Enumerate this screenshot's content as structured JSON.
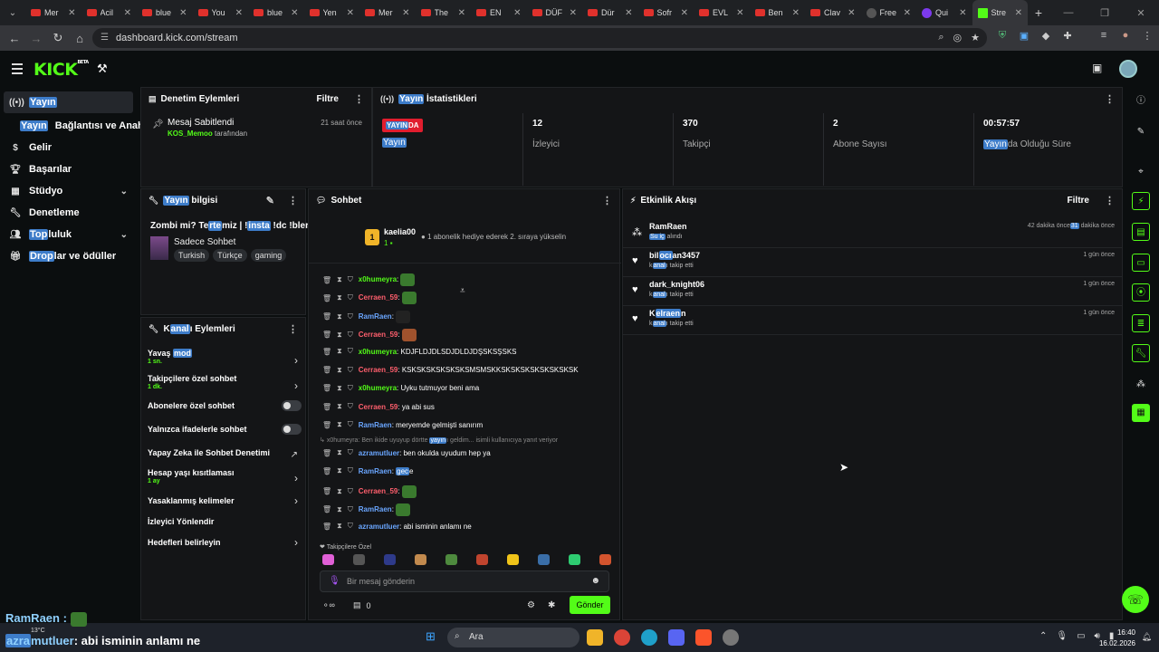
{
  "browser": {
    "tabs": [
      {
        "title": "Mer",
        "icon": "youtube-icon"
      },
      {
        "title": "Acil",
        "icon": "youtube-icon"
      },
      {
        "title": "blue",
        "icon": "youtube-icon"
      },
      {
        "title": "You",
        "icon": "youtube-icon"
      },
      {
        "title": "blue",
        "icon": "youtube-icon"
      },
      {
        "title": "Yen",
        "icon": "youtube-icon"
      },
      {
        "title": "Mer",
        "icon": "youtube-icon"
      },
      {
        "title": "The",
        "icon": "youtube-icon"
      },
      {
        "title": "EN",
        "icon": "youtube-icon"
      },
      {
        "title": "DÜF",
        "icon": "youtube-icon"
      },
      {
        "title": "Dür",
        "icon": "youtube-icon"
      },
      {
        "title": "Sofr",
        "icon": "youtube-icon"
      },
      {
        "title": "EVL",
        "icon": "youtube-icon"
      },
      {
        "title": "Ben",
        "icon": "youtube-icon"
      },
      {
        "title": "Clav",
        "icon": "youtube-icon"
      },
      {
        "title": "Free",
        "icon": "globe-icon"
      },
      {
        "title": "Qui",
        "icon": "quiz-icon"
      },
      {
        "title": "Stre",
        "icon": "kick-icon"
      }
    ],
    "url": "dashboard.kick.com/stream"
  },
  "sidebar": {
    "items": [
      {
        "label": "Yayın",
        "icon": "broadcast-icon"
      },
      {
        "label": "Bağlantısı ve Anahtar",
        "highlight": "Yayın"
      },
      {
        "label": "Gelir",
        "icon": "dollar-icon"
      },
      {
        "label": "Başarılar",
        "icon": "trophy-icon"
      },
      {
        "label": "Stüdyo",
        "icon": "grid-icon"
      },
      {
        "label": "Denetleme",
        "icon": "wrench-icon"
      },
      {
        "label": "luluk",
        "highlight": "Top",
        "icon": "community-icon"
      },
      {
        "label": "lar ve ödüller",
        "highlight": "Drop",
        "icon": "gift-icon"
      }
    ]
  },
  "moderation": {
    "title": "Denetim Eylemleri",
    "filter": "Filtre",
    "entry_title": "Mesaj Sabitlendi",
    "entry_user": "KOS_Memoo",
    "entry_suffix": "tarafından",
    "entry_time": "21 saat önce"
  },
  "stats": {
    "title_hl": "Yayın",
    "title_rest": " İstatistikleri",
    "live_badge_hl": "YAYIN",
    "live_badge_rest": "DA",
    "live_label": "Yayın",
    "viewers": "12",
    "viewers_label": "İzleyici",
    "followers": "370",
    "followers_label": "Takipçi",
    "subs": "2",
    "subs_label": "Abone Sayısı",
    "uptime": "00:57:57",
    "uptime_label_hl": "Yayın",
    "uptime_label_rest": "da Olduğu Süre"
  },
  "stream_info": {
    "title_hl": "Yayın",
    "title_rest": " bilgisi",
    "stream_title_a": "Zombi mi? Te",
    "stream_title_hl1": "rte",
    "stream_title_b": "miz | !",
    "stream_title_hl2": "insta",
    "stream_title_c": " !dc !blerp",
    "category": "Sadece Sohbet",
    "tags": [
      "Turkish",
      "Türkçe",
      "gaming"
    ]
  },
  "channel_actions": {
    "title_a": "K",
    "title_hl": "anal",
    "title_b": "ı Eylemleri",
    "slow_a": "Yavaş ",
    "slow_hl": "mod",
    "slow_sub": "1 sn.",
    "followers_only": "Takipçilere özel sohbet",
    "followers_only_sub": "1 dk.",
    "subs_only": "Abonelere özel sohbet",
    "emote_only": "Yalnızca ifadelerle sohbet",
    "ai_mod": "Yapay Zeka ile Sohbet Denetimi",
    "account_age": "Hesap yaşı kısıtlaması",
    "account_age_sub": "1 ay",
    "banned_words": "Yasaklanmış kelimeler",
    "viewer_redirect": "İzleyici Yönlendir",
    "goals": "Hedefleri belirleyin"
  },
  "chat": {
    "title": "Sohbet",
    "gift_badge": "1",
    "gift_user": "kaelia00",
    "gift_count": "1",
    "gift_msg": "1 abonelik hediye ederek 2. sıraya yükselin",
    "messages": [
      {
        "user": "x0humeyra",
        "text": "",
        "color": "#53fc18",
        "emote": "green"
      },
      {
        "user": "Cerraen_59",
        "text": "",
        "color": "#ff5f6d",
        "emote": "green"
      },
      {
        "user": "RamRaen",
        "text": "",
        "color": "#6aa6ff",
        "emote": "dark"
      },
      {
        "user": "Cerraen_59",
        "text": "",
        "color": "#ff5f6d",
        "emote": "brown"
      },
      {
        "user": "x0humeyra",
        "text": "KDJFLDJDLSDJDLDJDŞSKSŞSKS",
        "color": "#53fc18"
      },
      {
        "user": "Cerraen_59",
        "text": "KSKSKSKSKSKSKSMSMSKKSKSKSKSKSKSKSKSK",
        "color": "#ff5f6d"
      },
      {
        "user": "x0humeyra",
        "text": "Uyku tutmuyor beni ama",
        "color": "#53fc18"
      },
      {
        "user": "Cerraen_59",
        "text": "ya abi sus",
        "color": "#ff5f6d"
      },
      {
        "user": "RamRaen",
        "text": "meryemde gelmişti sanırım",
        "color": "#6aa6ff"
      }
    ],
    "reply_a": "x0humeyra: Ben ikide uyuyup dörtte ",
    "reply_hl": "yayın",
    "reply_b": "ı geldim... isimli kullanıcıya yanıt veriyor",
    "messages2": [
      {
        "user": "azramutluer",
        "text": "ben okulda uyudum hep ya",
        "color": "#6aa6ff"
      },
      {
        "user": "RamRaen",
        "text": "",
        "hl": "gec",
        "text2": "e",
        "color": "#6aa6ff"
      },
      {
        "user": "Cerraen_59",
        "text": "",
        "color": "#ff5f6d",
        "emote": "green"
      },
      {
        "user": "RamRaen",
        "text": "",
        "color": "#6aa6ff",
        "emote": "green"
      },
      {
        "user": "azramutluer",
        "text": "abi isminin anlamı ne",
        "color": "#6aa6ff"
      }
    ],
    "followers_only_label": "Takipçilere Özel",
    "placeholder": "Bir mesaj gönderin",
    "points": "0",
    "send": "Gönder"
  },
  "activity": {
    "title": "Etkinlik Akışı",
    "filter": "Filtre",
    "events": [
      {
        "name": "RamRaen",
        "desc_hl": "Su iç",
        "desc": " alındı",
        "time_a": "42 dakika önce",
        "time_hl": "31",
        "time_b": " dakika önce",
        "icon": "gift-icon"
      },
      {
        "name_a": "bil",
        "name_hl": "ocı",
        "name_b": "an3457",
        "desc_a": "k",
        "desc_hl": "anal",
        "desc": "ı takip etti",
        "time": "1 gün önce",
        "icon": "heart-icon"
      },
      {
        "name": "dark_knight06",
        "desc_a": "k",
        "desc_hl": "anal",
        "desc": "ı takip etti",
        "time": "1 gün önce",
        "icon": "heart-icon"
      },
      {
        "name_a": "K",
        "name_hl": "elraen",
        "name_b": "n",
        "desc_a": "k",
        "desc_hl": "anal",
        "desc": "ı takip etti",
        "time": "1 gün önce",
        "icon": "heart-icon"
      }
    ]
  },
  "overlay": {
    "line1_user": "RamRaen",
    "line2_user_a": "azra",
    "line2_user_b": "mutluer",
    "line2_text": ": abi isminin anlamı ne"
  },
  "taskbar": {
    "weather": "13°C",
    "search": "Ara",
    "time": "16:40",
    "date": "16.02.2026"
  },
  "colors": {
    "accent": "#53fc18",
    "highlight": "#3d7cc9",
    "live": "#e11d2e"
  }
}
